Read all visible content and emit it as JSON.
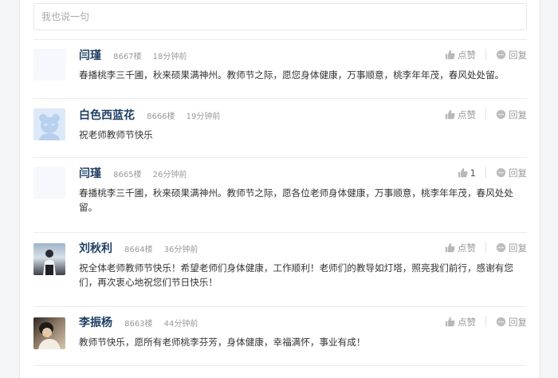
{
  "reply": {
    "placeholder": "我也说一句"
  },
  "actions": {
    "like_label": "点赞",
    "reply_label": "回复"
  },
  "comments": [
    {
      "user": "闫瑾",
      "floor": "8667楼",
      "time": "18分钟前",
      "likes": "点赞",
      "text": "春播桃李三千圃，秋来硕果满神州。教师节之际，愿您身体健康，万事顺意，桃李年年茂，春风处处留。"
    },
    {
      "user": "白色西蓝花",
      "floor": "8666楼",
      "time": "19分钟前",
      "likes": "点赞",
      "text": "祝老师教师节快乐"
    },
    {
      "user": "闫瑾",
      "floor": "8665楼",
      "time": "26分钟前",
      "likes": "1",
      "text": "春播桃李三千圃，秋来硕果满神州。教师节之际，愿各位老师身体健康，万事顺意，桃李年年茂，春风处处留。"
    },
    {
      "user": "刘秋利",
      "floor": "8664楼",
      "time": "36分钟前",
      "likes": "点赞",
      "text": "祝全体老师教师节快乐！希望老师们身体健康，工作顺利！老师们的教导如灯塔，照亮我们前行，感谢有您们，再次衷心地祝您们节日快乐！"
    },
    {
      "user": "李振杨",
      "floor": "8663楼",
      "time": "44分钟前",
      "likes": "点赞",
      "text": "教师节快乐，愿所有老师桃李芬芳，身体健康，幸福满怀，事业有成！"
    }
  ]
}
